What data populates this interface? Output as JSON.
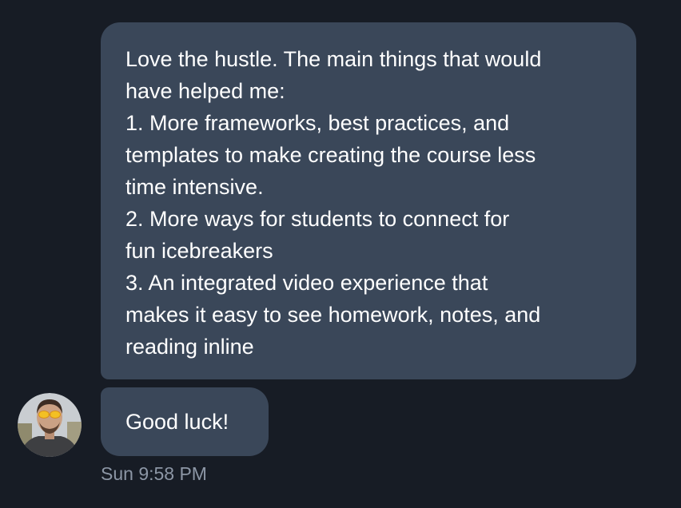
{
  "conversation": {
    "messages": [
      {
        "lines": [
          "Love the hustle. The main things that would",
          "have helped me:",
          "1. More frameworks, best practices, and",
          "templates to make creating the course less",
          "time intensive.",
          "2. More ways for students to connect for",
          "fun icebreakers",
          "3. An integrated video experience that",
          "makes it easy to see homework, notes, and",
          "reading inline"
        ]
      },
      {
        "text": "Good luck!"
      }
    ],
    "timestamp": "Sun 9:58 PM"
  },
  "colors": {
    "background": "#171c25",
    "bubble": "#3a4759",
    "message_text": "#ffffff",
    "timestamp_text": "#8c96a5"
  }
}
